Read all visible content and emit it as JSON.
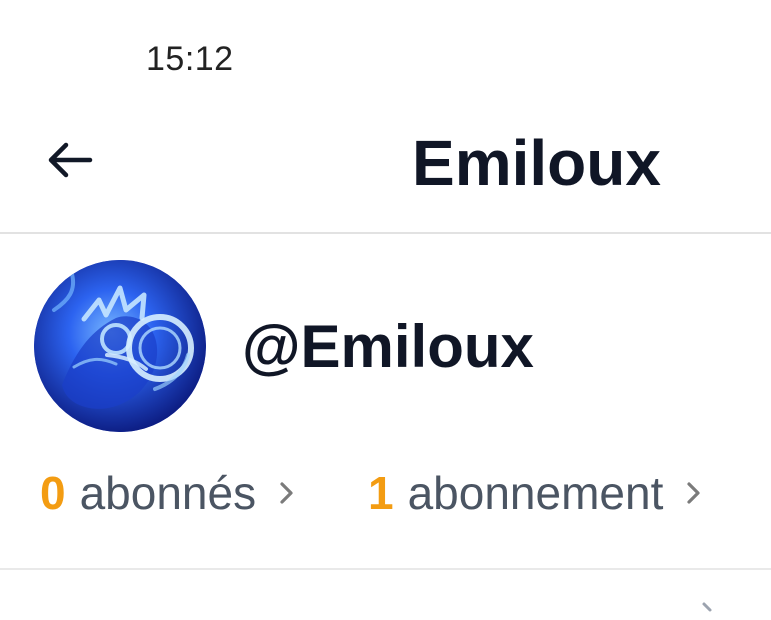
{
  "status_bar": {
    "time": "15:12"
  },
  "header": {
    "back_icon": "arrow-left-icon",
    "title": "Emiloux"
  },
  "profile": {
    "avatar": "avatar-image",
    "handle": "@Emiloux",
    "followers": {
      "count": "0",
      "label": "abonnés",
      "icon": "chevron-right-icon"
    },
    "following": {
      "count": "1",
      "label": "abonnement",
      "icon": "chevron-right-icon"
    }
  },
  "colors": {
    "accent": "#f39c12",
    "title_text": "#101626",
    "muted_text": "#4b5563",
    "avatar_blue": "#1f3fd0"
  }
}
